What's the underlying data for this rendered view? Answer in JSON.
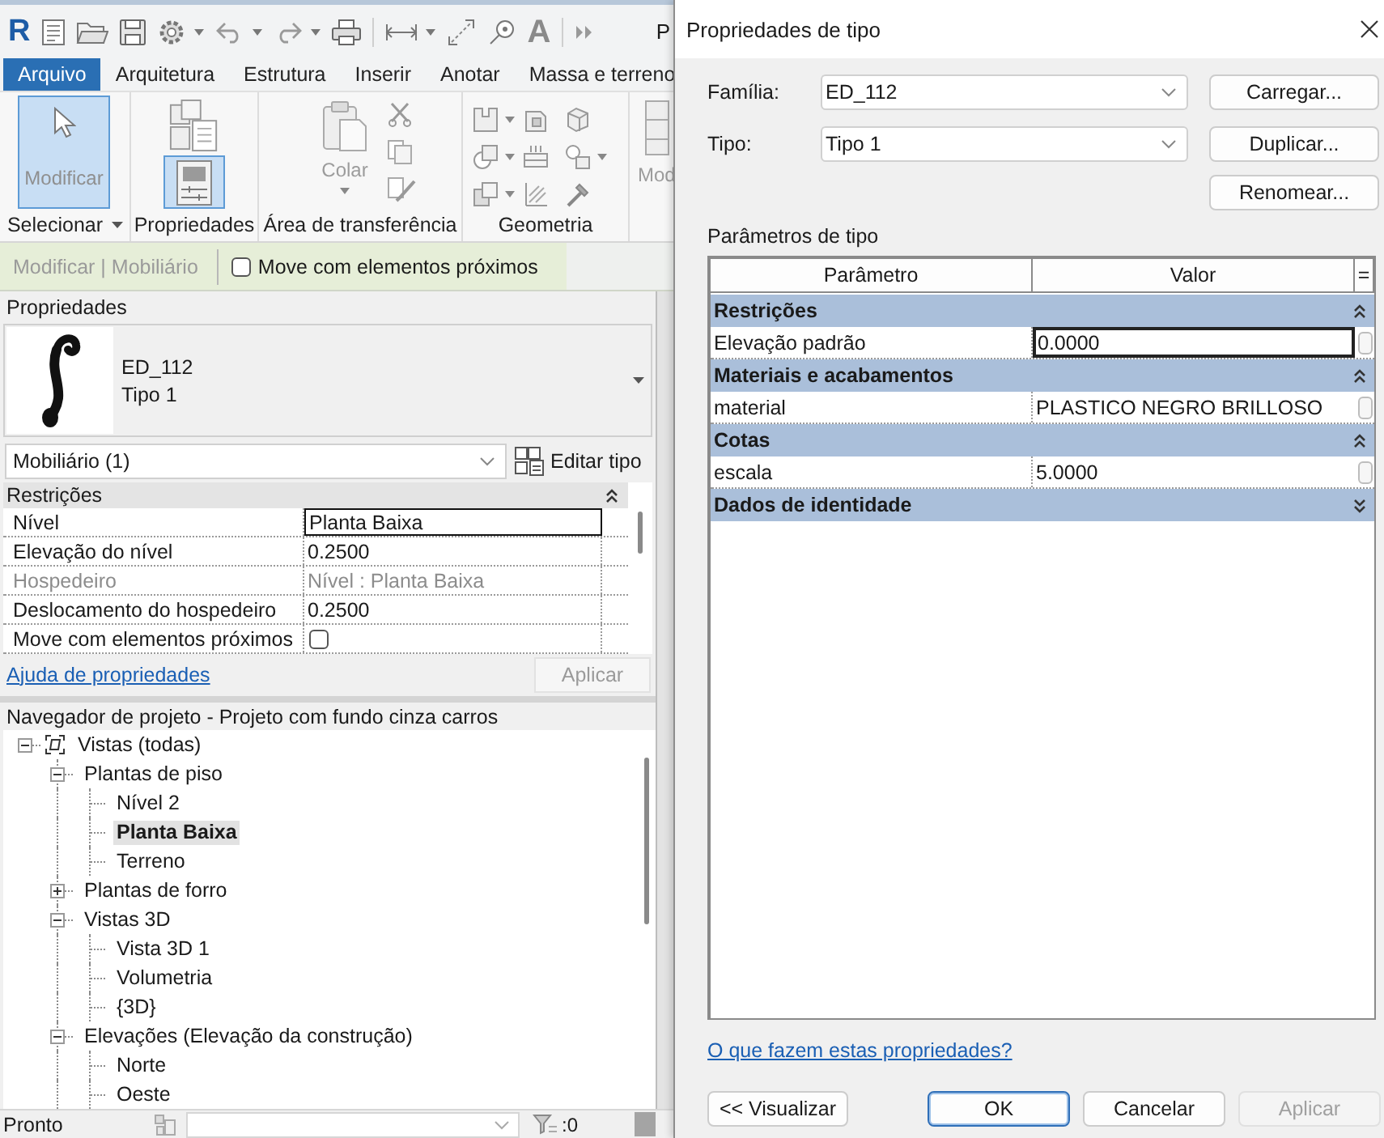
{
  "title_bar": {
    "logo": "R",
    "text_tool": "A",
    "partial_title": "P"
  },
  "ribbon_tabs": [
    {
      "label": "Arquivo",
      "selected": true
    },
    {
      "label": "Arquitetura",
      "selected": false
    },
    {
      "label": "Estrutura",
      "selected": false
    },
    {
      "label": "Inserir",
      "selected": false
    },
    {
      "label": "Anotar",
      "selected": false
    },
    {
      "label": "Massa e terreno",
      "selected": false
    }
  ],
  "ribbon_panels": [
    {
      "kind": "select",
      "label": "Selecionar",
      "menu": true,
      "buttons": [
        {
          "label": "Modificar",
          "selected": true
        }
      ]
    },
    {
      "kind": "properties",
      "label": "Propriedades",
      "menu": false,
      "buttons": [
        {
          "selected": false
        },
        {
          "selected": true
        }
      ]
    },
    {
      "kind": "clipboard",
      "label": "Área de transferência",
      "menu": false,
      "buttons": [
        {
          "label": "Colar",
          "disabled": true
        }
      ]
    },
    {
      "kind": "geometry",
      "label": "Geometria",
      "menu": false
    },
    {
      "kind": "partial",
      "buttons": [
        {
          "label": "Mod",
          "disabled": true
        }
      ]
    }
  ],
  "context_bar": {
    "label": "Modificar | Mobiliário",
    "option": {
      "label": "Move com elementos próximos",
      "checked": false
    }
  },
  "properties": {
    "title": "Propriedades",
    "type_name": "ED_112",
    "type_label": "Tipo 1",
    "category": "Mobiliário (1)",
    "edit_type": "Editar tipo",
    "groups": [
      {
        "name": "Restrições",
        "expanded": true,
        "rows": [
          {
            "kind": "text",
            "name": "Nível",
            "value": "Planta Baixa",
            "focused": true,
            "disabled": false
          },
          {
            "kind": "text",
            "name": "Elevação do nível",
            "value": "0.2500",
            "focused": false,
            "disabled": false
          },
          {
            "kind": "text",
            "name": "Hospedeiro",
            "value": "Nível : Planta Baixa",
            "focused": false,
            "disabled": true
          },
          {
            "kind": "text",
            "name": "Deslocamento do hospedeiro",
            "value": "0.2500",
            "focused": false,
            "disabled": false
          },
          {
            "kind": "checkbox",
            "name": "Move com elementos próximos",
            "checked": false,
            "focused": false,
            "disabled": false
          }
        ]
      }
    ],
    "help_link": "Ajuda de propriedades",
    "apply": {
      "label": "Aplicar",
      "disabled": true
    }
  },
  "project_browser": {
    "title": "Navegador de projeto - Projeto com fundo cinza carros",
    "tree": [
      {
        "label": "Vistas (todas)",
        "expanded": true,
        "selected": false,
        "children": [
          {
            "label": "Plantas de piso",
            "expanded": true,
            "selected": false,
            "children": [
              {
                "label": "Nível 2",
                "selected": false
              },
              {
                "label": "Planta Baixa",
                "selected": true
              },
              {
                "label": "Terreno",
                "selected": false
              }
            ]
          },
          {
            "label": "Plantas de forro",
            "expanded": false,
            "selected": false
          },
          {
            "label": "Vistas 3D",
            "expanded": true,
            "selected": false,
            "children": [
              {
                "label": "Vista 3D 1",
                "selected": false
              },
              {
                "label": "Volumetria",
                "selected": false
              },
              {
                "label": "{3D}",
                "selected": false
              }
            ]
          },
          {
            "label": "Elevações (Elevação da construção)",
            "expanded": true,
            "selected": false,
            "children": [
              {
                "label": "Norte",
                "selected": false
              },
              {
                "label": "Oeste",
                "selected": false
              }
            ]
          }
        ]
      }
    ]
  },
  "status_bar": {
    "text": "Pronto",
    "selection_count": ":0"
  },
  "dialog": {
    "title": "Propriedades de tipo",
    "fields": [
      {
        "label": "Família:",
        "value": "ED_112"
      },
      {
        "label": "Tipo:",
        "value": "Tipo 1"
      }
    ],
    "side_buttons": [
      "Carregar...",
      "Duplicar...",
      "Renomear..."
    ],
    "section_title": "Parâmetros de tipo",
    "table": {
      "columns": [
        "Parâmetro",
        "Valor",
        "="
      ],
      "groups": [
        {
          "name": "Restrições",
          "expanded": true,
          "rows": [
            {
              "name": "Elevação padrão",
              "value": "0.0000",
              "focused": true
            }
          ]
        },
        {
          "name": "Materiais e acabamentos",
          "expanded": true,
          "rows": [
            {
              "name": "material",
              "value": "PLASTICO NEGRO BRILLOSO",
              "focused": false
            }
          ]
        },
        {
          "name": "Cotas",
          "expanded": true,
          "rows": [
            {
              "name": "escala",
              "value": "5.0000",
              "focused": false
            }
          ]
        },
        {
          "name": "Dados de identidade",
          "expanded": false
        }
      ]
    },
    "help_link": "O que fazem estas propriedades?",
    "buttons": [
      {
        "label": "<< Visualizar",
        "default": false,
        "disabled": false
      },
      {
        "label": "OK",
        "default": true,
        "disabled": false
      },
      {
        "label": "Cancelar",
        "default": false,
        "disabled": false
      },
      {
        "label": "Aplicar",
        "default": false,
        "disabled": true
      }
    ]
  }
}
